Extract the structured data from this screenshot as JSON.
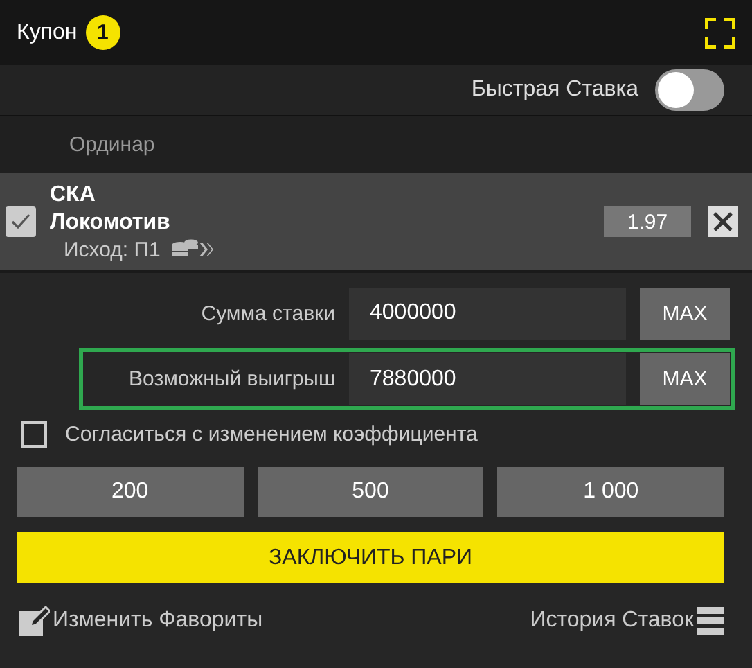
{
  "header": {
    "title": "Купон",
    "count": "1"
  },
  "quick_bet": {
    "label": "Быстрая Ставка",
    "on": false
  },
  "bet_type": "Ординар",
  "bet": {
    "checked": true,
    "team_1": "СКА",
    "team_2": "Локомотив",
    "outcome": "Исход: П1",
    "odds": "1.97"
  },
  "stake_rows": [
    {
      "label": "Сумма ставки",
      "value": "4000000",
      "button": "MAX",
      "highlighted": false
    },
    {
      "label": "Возможный выигрыш",
      "value": "7880000",
      "button": "MAX",
      "highlighted": true
    }
  ],
  "accept_changes": {
    "label": "Согласиться с изменением коэффициента",
    "checked": false
  },
  "quick_amounts": [
    "200",
    "500",
    "1 000"
  ],
  "place_bet": "ЗАКЛЮЧИТЬ ПАРИ",
  "footer": {
    "favorites": "Изменить Фавориты",
    "history": "История Ставок"
  }
}
